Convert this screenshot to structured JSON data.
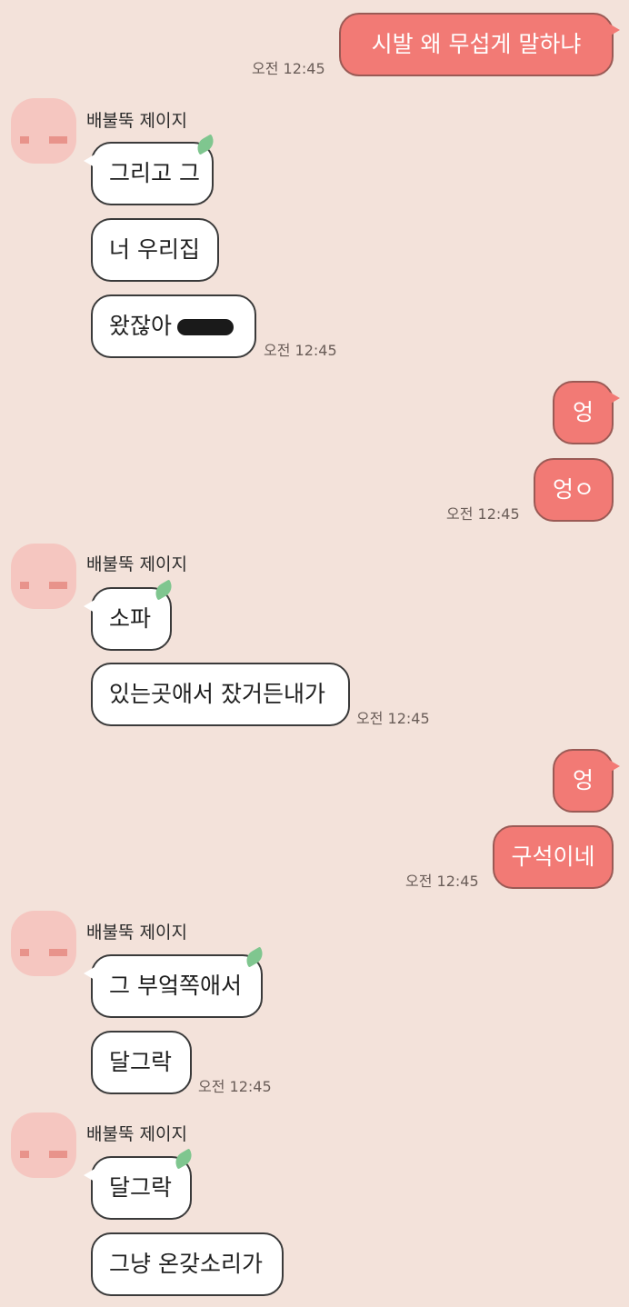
{
  "timestamp": "오전 12:45",
  "sender_name": "배불뚝 제이지",
  "colors": {
    "background": "#f3e2da",
    "my_bubble": "#f27a75",
    "their_bubble": "#ffffff",
    "avatar": "#f5c6c0"
  },
  "messages": {
    "m1": "시발 왜 무섭게 말하냐",
    "m2": "그리고 그",
    "m3": "너 우리집",
    "m4": "왔잖아",
    "m5": "엉",
    "m6": "엉ㅇ",
    "m7": "소파",
    "m8": "있는곳애서 잤거든내가",
    "m9": "엉",
    "m10": "구석이네",
    "m11": "그 부엌쪽애서",
    "m12": "달그락",
    "m13": "달그락",
    "m14": "그냥 온갖소리가"
  }
}
